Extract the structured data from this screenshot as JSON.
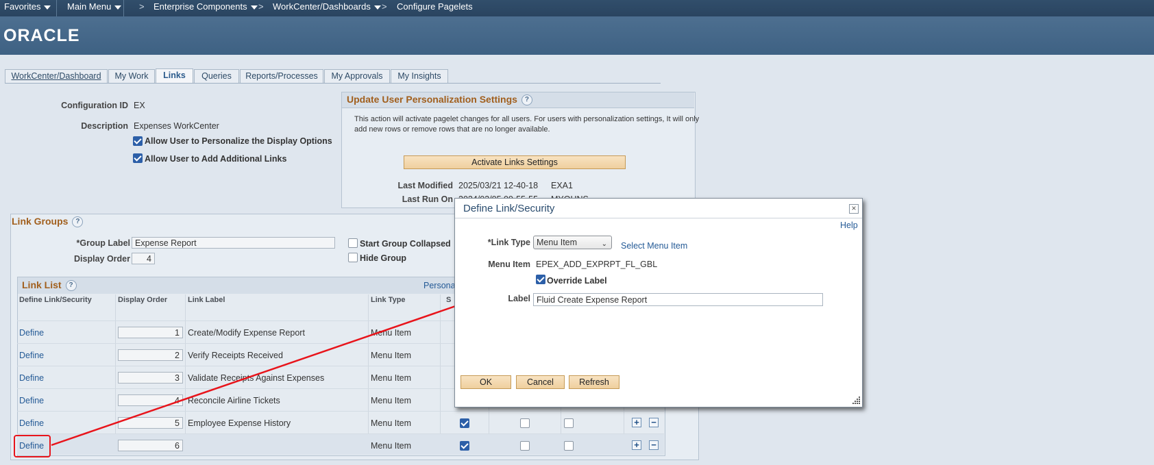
{
  "topnav": {
    "favorites": "Favorites",
    "main_menu": "Main Menu",
    "crumb1": "Enterprise Components",
    "crumb2": "WorkCenter/Dashboards",
    "crumb3": "Configure Pagelets",
    "crumb_sep": ">"
  },
  "brand": "ORACLE",
  "tabs": [
    {
      "label": "WorkCenter/Dashboard"
    },
    {
      "label": "My Work"
    },
    {
      "label": "Links"
    },
    {
      "label": "Queries"
    },
    {
      "label": "Reports/Processes"
    },
    {
      "label": "My Approvals"
    },
    {
      "label": "My Insights"
    }
  ],
  "config": {
    "id_label": "Configuration ID",
    "id_value": "EX",
    "desc_label": "Description",
    "desc_value": "Expenses WorkCenter",
    "allow_personalize": "Allow User to Personalize the Display Options",
    "allow_add_links": "Allow User to Add Additional Links"
  },
  "update_box": {
    "title": "Update User Personalization Settings",
    "help": "?",
    "text1": "This action will activate pagelet changes for all users.  For users with personalization settings, It will only",
    "text2": "add new rows or remove rows that are no longer available.",
    "button": "Activate Links Settings",
    "last_modified_label": "Last Modified",
    "last_modified_value": "2025/03/21 12-40-18",
    "last_modified_user": "EXA1",
    "last_run_label": "Last Run On",
    "last_run_value": "2024/03/05 09-55-55",
    "last_run_user": "MYOHNS"
  },
  "link_groups": {
    "title": "Link Groups",
    "help": "?",
    "group_label_label": "*Group Label",
    "group_label_value": "Expense Report",
    "display_order_label": "Display Order",
    "display_order_value": "4",
    "start_collapsed": "Start Group Collapsed",
    "hide_group": "Hide Group"
  },
  "link_list": {
    "title": "Link List",
    "help": "?",
    "personalize": "Persona",
    "headers": {
      "define": "Define Link/Security",
      "order": "Display Order",
      "label": "Link Label",
      "type": "Link Type",
      "s": "S"
    },
    "rows": [
      {
        "define": "Define",
        "order": "1",
        "label": "Create/Modify Expense Report",
        "type": "Menu Item"
      },
      {
        "define": "Define",
        "order": "2",
        "label": "Verify Receipts Received",
        "type": "Menu Item"
      },
      {
        "define": "Define",
        "order": "3",
        "label": "Validate Receipts Against Expenses",
        "type": "Menu Item"
      },
      {
        "define": "Define",
        "order": "4",
        "label": "Reconcile Airline Tickets",
        "type": "Menu Item"
      },
      {
        "define": "Define",
        "order": "5",
        "label": "Employee Expense History",
        "type": "Menu Item"
      },
      {
        "define": "Define",
        "order": "6",
        "label": "",
        "type": "Menu Item"
      }
    ],
    "plus": "+",
    "minus": "−"
  },
  "modal": {
    "title": "Define Link/Security",
    "close": "×",
    "help": "Help",
    "link_type_label": "*Link Type",
    "link_type_value": "Menu Item",
    "select_menu_item": "Select Menu Item",
    "menu_item_label": "Menu Item",
    "menu_item_value": "EPEX_ADD_EXPRPT_FL_GBL",
    "override_label": "Override Label",
    "label_label": "Label",
    "label_value": "Fluid Create Expense Report",
    "ok": "OK",
    "cancel": "Cancel",
    "refresh": "Refresh"
  },
  "colors": {
    "annotation": "#e8141b",
    "header": "#3e6183",
    "section_title": "#a15f1d"
  }
}
